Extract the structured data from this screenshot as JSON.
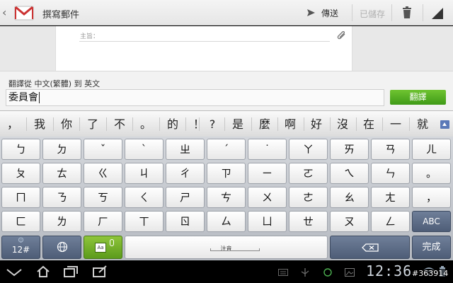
{
  "actionbar": {
    "title": "撰寫郵件",
    "send_label": "傳送",
    "saved_label": "已儲存",
    "accent": "#cc3333"
  },
  "compose": {
    "subject_placeholder": "主旨："
  },
  "translate": {
    "label": "翻譯從 中文(繁體) 到 英文",
    "input_value": "委員會",
    "button_label": "翻譯",
    "button_color": "#4ea81f"
  },
  "candidates": [
    "，",
    "我",
    "你",
    "了",
    "不",
    "。",
    "的",
    "！",
    "?",
    "是",
    "麼",
    "啊",
    "好",
    "沒",
    "在",
    "一",
    "就"
  ],
  "keyboard": {
    "rows": [
      [
        "ㄅ",
        "ㄉ",
        "ˇ",
        "ˋ",
        "ㄓ",
        "ˊ",
        "˙",
        "ㄚ",
        "ㄞ",
        "ㄢ",
        "ㄦ"
      ],
      [
        "ㄆ",
        "ㄊ",
        "ㄍ",
        "ㄐ",
        "ㄔ",
        "ㄗ",
        "ㄧ",
        "ㄛ",
        "ㄟ",
        "ㄣ",
        "。"
      ],
      [
        "ㄇ",
        "ㄋ",
        "ㄎ",
        "ㄑ",
        "ㄕ",
        "ㄘ",
        "ㄨ",
        "ㄜ",
        "ㄠ",
        "ㄤ",
        "，"
      ],
      [
        "ㄈ",
        "ㄌ",
        "ㄏ",
        "ㄒ",
        "ㄖ",
        "ㄙ",
        "ㄩ",
        "ㄝ",
        "ㄡ",
        "ㄥ",
        "ABC"
      ]
    ],
    "symbols_label": "12#",
    "symbols_dots": "☺",
    "ime_label": "Aa",
    "space_label": "注音",
    "done_label": "完成",
    "key_accent": "#56657f"
  },
  "system": {
    "clock": "12:36"
  },
  "watermark": "#363914"
}
